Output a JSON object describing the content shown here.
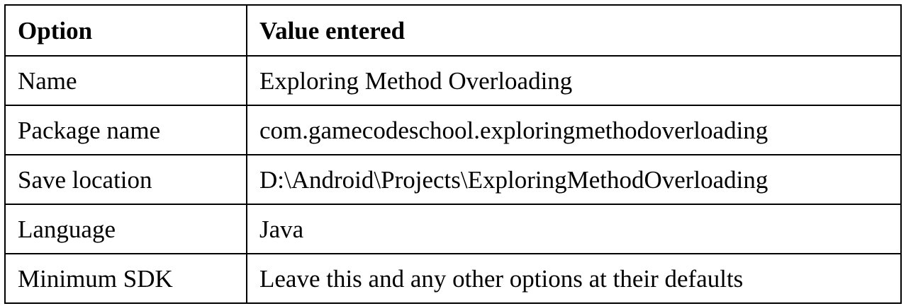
{
  "table": {
    "headers": [
      "Option",
      "Value entered"
    ],
    "rows": [
      [
        "Name",
        "Exploring Method Overloading"
      ],
      [
        "Package name",
        "com.gamecodeschool.exploringmethodoverloading"
      ],
      [
        "Save location",
        "D:\\Android\\Projects\\ExploringMethodOverloading"
      ],
      [
        "Language",
        "Java"
      ],
      [
        "Minimum SDK",
        "Leave this and any other options at their defaults"
      ]
    ]
  }
}
